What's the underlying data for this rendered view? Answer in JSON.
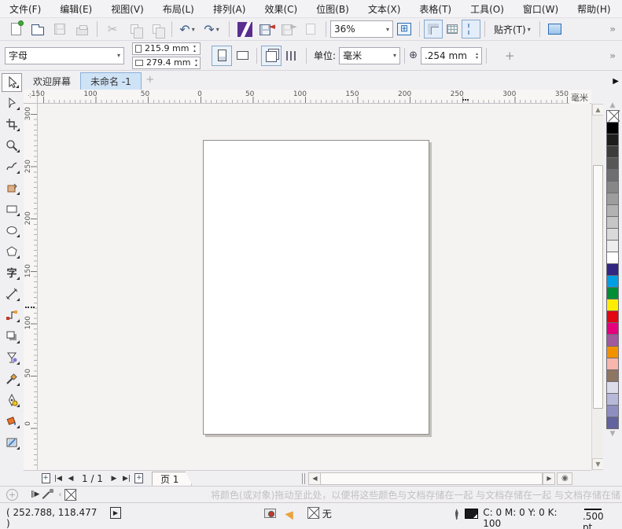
{
  "menu_bar": {
    "items": [
      "文件(F)",
      "编辑(E)",
      "视图(V)",
      "布局(L)",
      "排列(A)",
      "效果(C)",
      "位图(B)",
      "文本(X)",
      "表格(T)",
      "工具(O)",
      "窗口(W)",
      "帮助(H)"
    ]
  },
  "standard_toolbar": {
    "zoom_level": "36%",
    "snap_label": "贴齐(T)",
    "overflow": "»",
    "icons": [
      "new-document",
      "open",
      "save",
      "print",
      "cut",
      "copy",
      "paste",
      "undo",
      "redo",
      "application-launcher",
      "import",
      "export",
      "publish-pdf",
      "zoom-level",
      "full-screen-preview",
      "show-rulers",
      "show-grid",
      "show-guidelines",
      "snap-to",
      "options"
    ]
  },
  "property_bar": {
    "paper_type": "字母",
    "paper_width": "215.9 mm",
    "paper_height": "279.4 mm",
    "units_label": "单位:",
    "units_value": "毫米",
    "nudge_value": ".254 mm",
    "add_label": "+",
    "overflow": "»"
  },
  "document_tabs": {
    "welcome_tab": "欢迎屏幕",
    "document_tab": "未命名 -1",
    "new_tab": "+"
  },
  "toolbox": {
    "selected": "pick-tool",
    "tools": [
      "pick",
      "shape",
      "crop",
      "zoom",
      "freehand",
      "smart-fill",
      "rectangle",
      "ellipse",
      "polygon",
      "text",
      "parallel-dimension",
      "straight-line-connector",
      "drop-shadow",
      "contour",
      "color-eyedropper",
      "outline-pen",
      "fill",
      "interactive-fill"
    ]
  },
  "rulers": {
    "unit": "毫米",
    "horizontal_labels": [
      "150",
      "100",
      "50",
      "0",
      "50",
      "100",
      "150",
      "200",
      "250",
      "300",
      "350"
    ],
    "vertical_labels": [
      "300",
      "250",
      "200",
      "150",
      "100",
      "50",
      "0"
    ]
  },
  "color_palette": [
    "none",
    "#000000",
    "#1d1d1b",
    "#3c3c3b",
    "#575756",
    "#706f6f",
    "#878787",
    "#9d9d9c",
    "#b2b2b2",
    "#c6c6c6",
    "#dadada",
    "#ededed",
    "#ffffff",
    "#312783",
    "#009fe3",
    "#008d36",
    "#ffed00",
    "#e30613",
    "#e6007e",
    "#a05a9e",
    "#f39200",
    "#f8b6ad",
    "#8d7662",
    "#dcdcea",
    "#b8b8d8",
    "#8e8ec0",
    "#62629e"
  ],
  "page_bar": {
    "page_indicator": "1 / 1",
    "page_tab": "页 1"
  },
  "document_palette": {
    "hint": "将颜色(或对象)拖动至此处，以便将这些颜色与文档存储在一起  与文档存储在一起  与文档存储在储"
  },
  "status_bar": {
    "cursor_position": "( 252.788, 118.477 )",
    "fill_none_label": "无",
    "outline_cmyk": "C: 0 M: 0 Y: 0 K: 100",
    "outline_width": ".500 pt"
  }
}
